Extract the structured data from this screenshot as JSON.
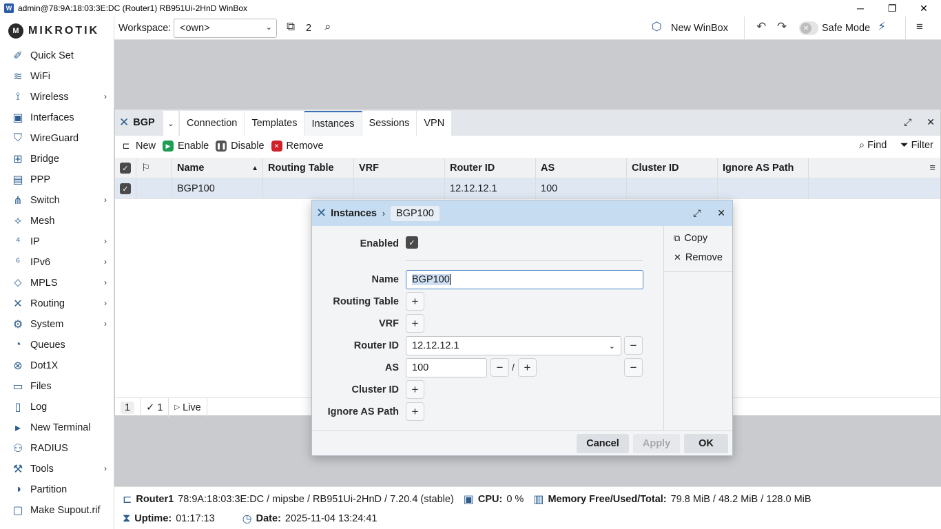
{
  "window": {
    "title": "admin@78:9A:18:03:3E:DC (Router1) RB951Ui-2HnD WinBox"
  },
  "logo": "MIKROTIK",
  "sidebar": {
    "items": [
      {
        "label": "Quick Set",
        "icon": "wand-icon",
        "glyph": "✐",
        "arrow": false
      },
      {
        "label": "WiFi",
        "icon": "wifi-icon",
        "glyph": "≋",
        "arrow": false
      },
      {
        "label": "Wireless",
        "icon": "antenna-icon",
        "glyph": "⟟",
        "arrow": true
      },
      {
        "label": "Interfaces",
        "icon": "interfaces-icon",
        "glyph": "▣",
        "arrow": false
      },
      {
        "label": "WireGuard",
        "icon": "shield-icon",
        "glyph": "⛉",
        "arrow": false
      },
      {
        "label": "Bridge",
        "icon": "bridge-icon",
        "glyph": "⊞",
        "arrow": false
      },
      {
        "label": "PPP",
        "icon": "ppp-icon",
        "glyph": "▤",
        "arrow": false
      },
      {
        "label": "Switch",
        "icon": "switch-icon",
        "glyph": "⋔",
        "arrow": true
      },
      {
        "label": "Mesh",
        "icon": "mesh-icon",
        "glyph": "⟡",
        "arrow": false
      },
      {
        "label": "IP",
        "icon": "ip-icon",
        "glyph": "⁴",
        "arrow": true
      },
      {
        "label": "IPv6",
        "icon": "ipv6-icon",
        "glyph": "⁶",
        "arrow": true
      },
      {
        "label": "MPLS",
        "icon": "tag-icon",
        "glyph": "⬦",
        "arrow": true
      },
      {
        "label": "Routing",
        "icon": "routing-icon",
        "glyph": "✕",
        "arrow": true
      },
      {
        "label": "System",
        "icon": "gear-icon",
        "glyph": "⚙",
        "arrow": true
      },
      {
        "label": "Queues",
        "icon": "gauge-icon",
        "glyph": "◔",
        "arrow": false
      },
      {
        "label": "Dot1X",
        "icon": "dot1x-icon",
        "glyph": "⊗",
        "arrow": false
      },
      {
        "label": "Files",
        "icon": "folder-icon",
        "glyph": "▭",
        "arrow": false
      },
      {
        "label": "Log",
        "icon": "log-icon",
        "glyph": "▯",
        "arrow": false
      },
      {
        "label": "New Terminal",
        "icon": "terminal-icon",
        "glyph": "▸",
        "arrow": false
      },
      {
        "label": "RADIUS",
        "icon": "radius-icon",
        "glyph": "⚇",
        "arrow": false
      },
      {
        "label": "Tools",
        "icon": "tools-icon",
        "glyph": "⚒",
        "arrow": true
      },
      {
        "label": "Partition",
        "icon": "partition-icon",
        "glyph": "◑",
        "arrow": false
      },
      {
        "label": "Make Supout.rif",
        "icon": "supout-icon",
        "glyph": "▢",
        "arrow": false
      }
    ]
  },
  "toolbar": {
    "workspace_label": "Workspace:",
    "workspace_value": "<own>",
    "window_count": "2",
    "new_winbox": "New WinBox",
    "safe_mode": "Safe Mode"
  },
  "bgp": {
    "title": "BGP",
    "tabs": [
      "Connection",
      "Templates",
      "Instances",
      "Sessions",
      "VPN"
    ],
    "active_tab": "Instances",
    "actions": {
      "new": "New",
      "enable": "Enable",
      "disable": "Disable",
      "remove": "Remove",
      "find": "Find",
      "filter": "Filter"
    },
    "columns": [
      "Name",
      "Routing Table",
      "VRF",
      "Router ID",
      "AS",
      "Cluster ID",
      "Ignore AS Path"
    ],
    "rows": [
      {
        "name": "BGP100",
        "routing_table": "",
        "vrf": "",
        "router_id": "12.12.12.1",
        "as": "100",
        "cluster_id": "",
        "ignore_as_path": ""
      }
    ],
    "status": {
      "count": "1",
      "selected": "1",
      "live": "Live"
    }
  },
  "dialog": {
    "crumb": "Instances",
    "item": "BGP100",
    "labels": {
      "enabled": "Enabled",
      "name": "Name",
      "routing_table": "Routing Table",
      "vrf": "VRF",
      "router_id": "Router ID",
      "as": "AS",
      "cluster_id": "Cluster ID",
      "ignore_as_path": "Ignore AS Path"
    },
    "values": {
      "name": "BGP100",
      "router_id": "12.12.12.1",
      "as": "100",
      "as_sep": "/"
    },
    "side": {
      "copy": "Copy",
      "remove": "Remove"
    },
    "buttons": {
      "cancel": "Cancel",
      "apply": "Apply",
      "ok": "OK"
    }
  },
  "statusbar": {
    "router": "Router1",
    "router_info": "78:9A:18:03:3E:DC / mipsbe / RB951Ui-2HnD / 7.20.4 (stable)",
    "cpu_label": "CPU:",
    "cpu_value": "0 %",
    "mem_label": "Memory Free/Used/Total:",
    "mem_value": "79.8 MiB / 48.2 MiB / 128.0 MiB",
    "uptime_label": "Uptime:",
    "uptime_value": "01:17:13",
    "date_label": "Date:",
    "date_value": "2025-11-04 13:24:41"
  }
}
